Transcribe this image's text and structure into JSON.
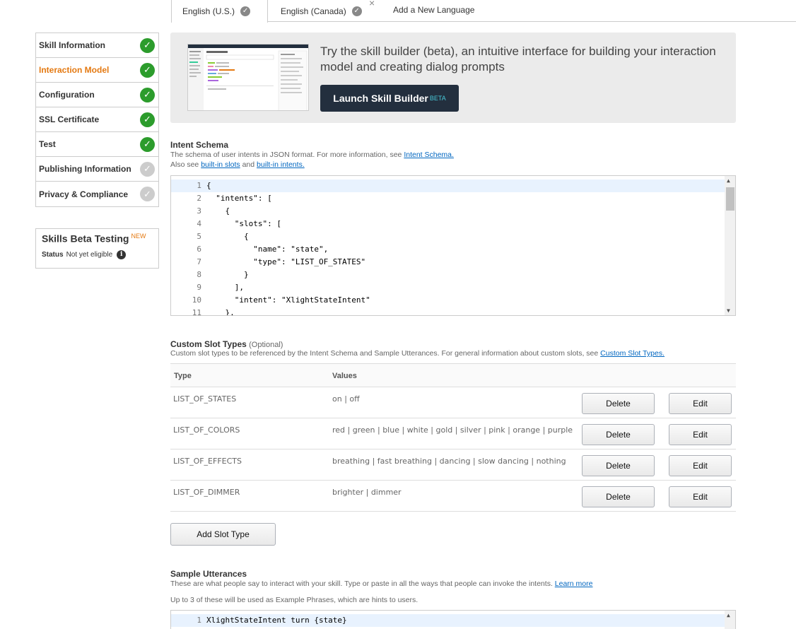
{
  "tabs": {
    "items": [
      {
        "label": "English (U.S.)"
      },
      {
        "label": "English (Canada)"
      }
    ],
    "add_label": "Add a New Language",
    "close_glyph": "×"
  },
  "nav": {
    "items": [
      {
        "label": "Skill Information",
        "status": "complete"
      },
      {
        "label": "Interaction Model",
        "status": "complete",
        "active": true
      },
      {
        "label": "Configuration",
        "status": "complete"
      },
      {
        "label": "SSL Certificate",
        "status": "complete"
      },
      {
        "label": "Test",
        "status": "complete"
      },
      {
        "label": "Publishing Information",
        "status": "incomplete"
      },
      {
        "label": "Privacy & Compliance",
        "status": "incomplete"
      }
    ]
  },
  "beta_testing": {
    "title": "Skills Beta Testing",
    "badge": "NEW",
    "status_label": "Status",
    "status_value": "Not yet eligible"
  },
  "promo": {
    "text": "Try the skill builder (beta), an intuitive interface for building your interaction model and creating dialog prompts",
    "button_label": "Launch Skill Builder",
    "button_badge": "BETA"
  },
  "intent_schema": {
    "title": "Intent Schema",
    "desc_prefix": "The schema of user intents in JSON format. For more information, see",
    "desc_link": "Intent Schema.",
    "also_prefix": "Also see",
    "also_link1": "built-in slots",
    "also_and": "and",
    "also_link2": "built-in intents.",
    "lines": [
      "{",
      "  \"intents\": [",
      "    {",
      "      \"slots\": [",
      "        {",
      "          \"name\": \"state\",",
      "          \"type\": \"LIST_OF_STATES\"",
      "        }",
      "      ],",
      "      \"intent\": \"XlightStateIntent\"",
      "    },"
    ]
  },
  "custom_slots": {
    "title": "Custom Slot Types",
    "optional": "(Optional)",
    "desc_prefix": "Custom slot types to be referenced by the Intent Schema and Sample Utterances. For general information about custom slots, see",
    "desc_link": "Custom Slot Types.",
    "col_type": "Type",
    "col_values": "Values",
    "delete_label": "Delete",
    "edit_label": "Edit",
    "add_label": "Add Slot Type",
    "rows": [
      {
        "type": "LIST_OF_STATES",
        "values": "on | off"
      },
      {
        "type": "LIST_OF_COLORS",
        "values": "red | green | blue | white | gold | silver | pink | orange | purple"
      },
      {
        "type": "LIST_OF_EFFECTS",
        "values": "breathing | fast breathing | dancing | slow dancing | nothing"
      },
      {
        "type": "LIST_OF_DIMMER",
        "values": "brighter | dimmer"
      }
    ]
  },
  "sample_utterances": {
    "title": "Sample Utterances",
    "desc": "These are what people say to interact with your skill. Type or paste in all the ways that people can invoke the intents.",
    "learn_more": "Learn more",
    "hint": "Up to 3 of these will be used as Example Phrases, which are hints to users.",
    "lines": [
      "XlightStateIntent turn {state}"
    ]
  },
  "colors": {
    "accent_orange": "#e47911",
    "check_green": "#2c9c2c",
    "launch_button": "#232f3e"
  }
}
